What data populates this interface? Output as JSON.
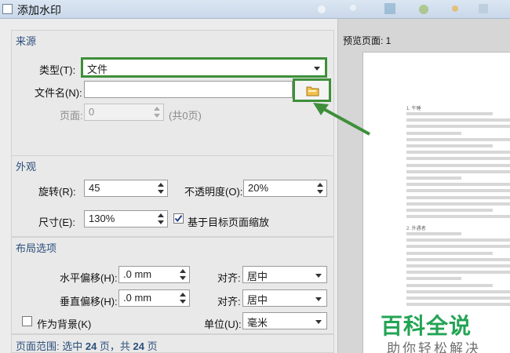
{
  "window": {
    "title": "添加水印"
  },
  "source": {
    "header": "来源",
    "type_label": "类型(T):",
    "type_value": "文件",
    "filename_label": "文件名(N):",
    "filename_value": "",
    "page_label": "页面:",
    "page_value": "0",
    "page_total": "(共0页)"
  },
  "appearance": {
    "header": "外观",
    "rotation_label": "旋转(R):",
    "rotation_value": "45",
    "opacity_label": "不透明度(O):",
    "opacity_value": "20%",
    "size_label": "尺寸(E):",
    "size_value": "130%",
    "scale_checkbox_label": "基于目标页面缩放",
    "scale_checked": true
  },
  "layout": {
    "header": "布局选项",
    "h_offset_label": "水平偏移(H):",
    "h_offset_value": ".0 mm",
    "h_align_label": "对齐:",
    "h_align_value": "居中",
    "v_offset_label": "垂直偏移(H):",
    "v_offset_value": ".0 mm",
    "v_align_label": "对齐:",
    "v_align_value": "居中",
    "background_label": "作为背景(K)",
    "background_checked": false,
    "unit_label": "单位(U):",
    "unit_value": "毫米"
  },
  "page_range": {
    "label": "页面范围: 选中 ",
    "selected": "24",
    "sep": " 页，共 ",
    "total": "24",
    "suffix": " 页"
  },
  "preview": {
    "label": "预览页面: 1",
    "snippets": [
      "1. 午睡",
      "2. 外遇者"
    ]
  },
  "watermark": {
    "title": "百科全说",
    "subtitle": "助你轻松解决"
  },
  "colors": {
    "accent_green": "#3e8f3a",
    "section_header": "#2c4f7c",
    "watermark_green": "#23a455"
  },
  "icons": {
    "browse": "folder-icon",
    "check": "checkmark-icon"
  }
}
